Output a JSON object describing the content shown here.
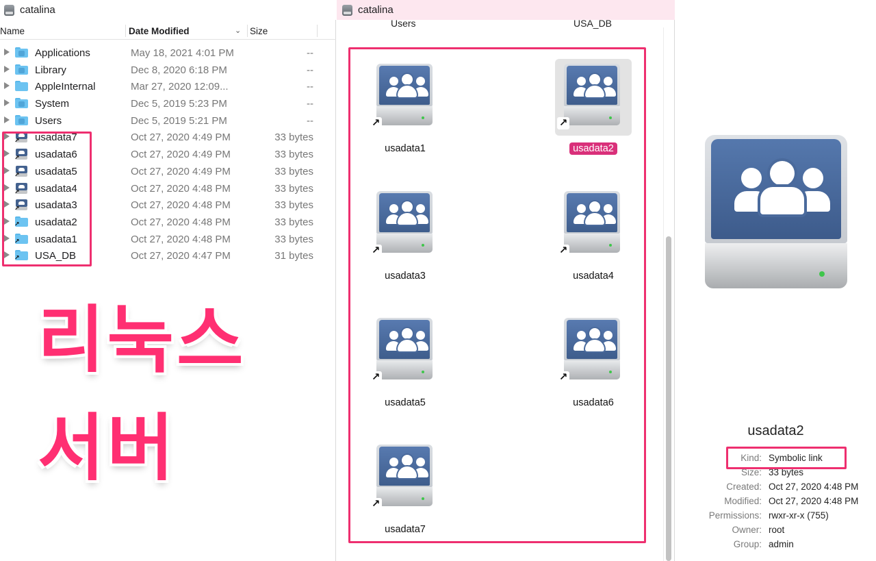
{
  "left_window": {
    "title": "catalina",
    "columns": {
      "name": "Name",
      "date_modified": "Date Modified",
      "size": "Size"
    },
    "rows": [
      {
        "name": "Applications",
        "date": "May 18, 2021 4:01 PM",
        "size": "--",
        "icon": "folder-apps-icon"
      },
      {
        "name": "Library",
        "date": "Dec 8, 2020 6:18 PM",
        "size": "--",
        "icon": "folder-library-icon"
      },
      {
        "name": "AppleInternal",
        "date": "Mar 27, 2020 12:09...",
        "size": "--",
        "icon": "folder-icon"
      },
      {
        "name": "System",
        "date": "Dec 5, 2019 5:23 PM",
        "size": "--",
        "icon": "folder-system-icon"
      },
      {
        "name": "Users",
        "date": "Dec 5, 2019 5:21 PM",
        "size": "--",
        "icon": "folder-users-icon"
      },
      {
        "name": "usadata7",
        "date": "Oct 27, 2020 4:49 PM",
        "size": "33 bytes",
        "icon": "network-drive-alias-icon"
      },
      {
        "name": "usadata6",
        "date": "Oct 27, 2020 4:49 PM",
        "size": "33 bytes",
        "icon": "network-drive-alias-icon"
      },
      {
        "name": "usadata5",
        "date": "Oct 27, 2020 4:49 PM",
        "size": "33 bytes",
        "icon": "network-drive-alias-icon"
      },
      {
        "name": "usadata4",
        "date": "Oct 27, 2020 4:48 PM",
        "size": "33 bytes",
        "icon": "network-drive-alias-icon"
      },
      {
        "name": "usadata3",
        "date": "Oct 27, 2020 4:48 PM",
        "size": "33 bytes",
        "icon": "network-drive-alias-icon"
      },
      {
        "name": "usadata2",
        "date": "Oct 27, 2020 4:48 PM",
        "size": "33 bytes",
        "icon": "folder-alias-icon"
      },
      {
        "name": "usadata1",
        "date": "Oct 27, 2020 4:48 PM",
        "size": "33 bytes",
        "icon": "folder-alias-icon"
      },
      {
        "name": "USA_DB",
        "date": "Oct 27, 2020 4:47 PM",
        "size": "31 bytes",
        "icon": "folder-alias-icon"
      }
    ]
  },
  "overlay_text": {
    "line1": "리눅스",
    "line2": "서버"
  },
  "middle_window": {
    "title": "catalina",
    "partial_labels": [
      "Users",
      "USA_DB"
    ],
    "icons": [
      {
        "label": "usadata1",
        "selected": false
      },
      {
        "label": "usadata2",
        "selected": true
      },
      {
        "label": "usadata3",
        "selected": false
      },
      {
        "label": "usadata4",
        "selected": false
      },
      {
        "label": "usadata5",
        "selected": false
      },
      {
        "label": "usadata6",
        "selected": false
      },
      {
        "label": "usadata7",
        "selected": false
      }
    ]
  },
  "preview": {
    "name": "usadata2",
    "info": [
      {
        "key": "Kind:",
        "value": "Symbolic link"
      },
      {
        "key": "Size:",
        "value": "33 bytes"
      },
      {
        "key": "Created:",
        "value": "Oct 27, 2020 4:48 PM"
      },
      {
        "key": "Modified:",
        "value": "Oct 27, 2020 4:48 PM"
      },
      {
        "key": "Permissions:",
        "value": "rwxr-xr-x (755)"
      },
      {
        "key": "Owner:",
        "value": "root"
      },
      {
        "key": "Group:",
        "value": "admin"
      }
    ]
  },
  "colors": {
    "highlight": "#ee2f6f",
    "selection_label": "#d9307a",
    "drive_face": "#4a6a9c"
  }
}
